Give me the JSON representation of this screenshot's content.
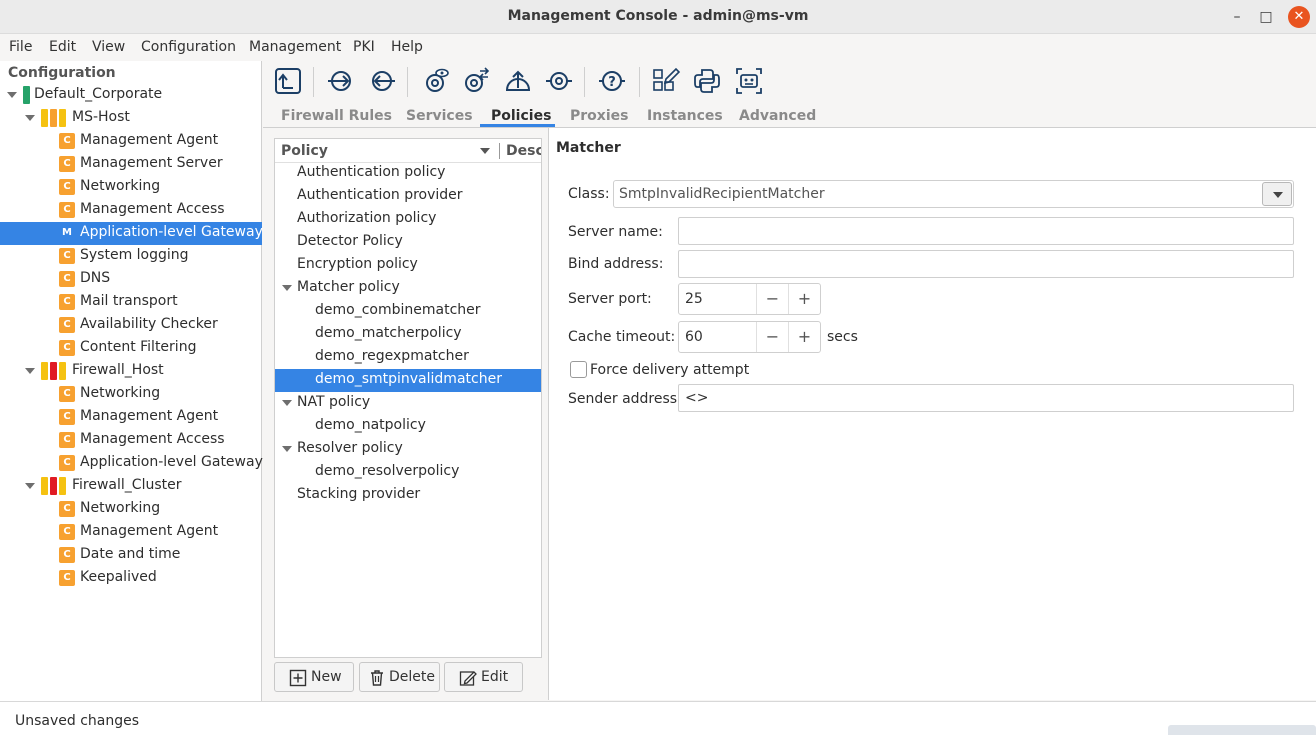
{
  "window": {
    "title": "Management Console - admin@ms-vm",
    "minimize": "–",
    "maximize": "□",
    "close": "✕"
  },
  "menu": [
    "File",
    "Edit",
    "View",
    "Configuration",
    "Management",
    "PKI",
    "Help"
  ],
  "tree": {
    "header": "Configuration",
    "root": "Default_Corporate",
    "hosts": [
      {
        "name": "MS-Host",
        "components": [
          "Management Agent",
          "Management Server",
          "Networking",
          "Management Access",
          "Application-level Gateway",
          "System logging",
          "DNS",
          "Mail transport",
          "Availability Checker",
          "Content Filtering"
        ]
      },
      {
        "name": "Firewall_Host",
        "components": [
          "Networking",
          "Management Agent",
          "Management Access",
          "Application-level Gateway"
        ]
      },
      {
        "name": "Firewall_Cluster",
        "components": [
          "Networking",
          "Management Agent",
          "Date and time",
          "Keepalived"
        ]
      }
    ],
    "badge_c": "C",
    "badge_m": "M",
    "selected": "Application-level Gateway"
  },
  "toolbar_icons": [
    "upload-arrow-icon",
    "connect-icon",
    "disconnect-icon",
    "view-config-icon",
    "compare-icon",
    "upload-config-icon",
    "control-service-icon",
    "help-icon",
    "edit-layout-icon",
    "python-icon",
    "status-monitor-icon"
  ],
  "tabs": [
    "Firewall Rules",
    "Services",
    "Policies",
    "Proxies",
    "Instances",
    "Advanced"
  ],
  "active_tab": "Policies",
  "policy_list": {
    "col_policy": "Policy",
    "col_desc": "Description",
    "rows": [
      {
        "label": "Authentication policy",
        "level": 0
      },
      {
        "label": "Authentication provider",
        "level": 0
      },
      {
        "label": "Authorization policy",
        "level": 0
      },
      {
        "label": "Detector Policy",
        "level": 0
      },
      {
        "label": "Encryption policy",
        "level": 0
      },
      {
        "label": "Matcher policy",
        "level": 0,
        "expanded": true
      },
      {
        "label": "demo_combinematcher",
        "level": 1
      },
      {
        "label": "demo_matcherpolicy",
        "level": 1
      },
      {
        "label": "demo_regexpmatcher",
        "level": 1
      },
      {
        "label": "demo_smtpinvalidmatcher",
        "level": 1,
        "selected": true
      },
      {
        "label": "NAT policy",
        "level": 0,
        "expanded": true
      },
      {
        "label": "demo_natpolicy",
        "level": 1
      },
      {
        "label": "Resolver policy",
        "level": 0,
        "expanded": true
      },
      {
        "label": "demo_resolverpolicy",
        "level": 1
      },
      {
        "label": "Stacking provider",
        "level": 0
      }
    ],
    "buttons": {
      "new": "New",
      "delete": "Delete",
      "edit": "Edit"
    }
  },
  "detail": {
    "title": "Matcher",
    "class_label": "Class:",
    "class_value": "SmtpInvalidRecipientMatcher",
    "server_name_label": "Server name:",
    "server_name_value": "",
    "bind_address_label": "Bind address:",
    "bind_address_value": "",
    "server_port_label": "Server port:",
    "server_port_value": "25",
    "cache_timeout_label": "Cache timeout:",
    "cache_timeout_value": "60",
    "cache_timeout_unit": "secs",
    "force_delivery_label": "Force delivery attempt",
    "force_delivery_checked": false,
    "sender_address_label": "Sender address:",
    "sender_address_value": "<>",
    "minus": "−",
    "plus": "+"
  },
  "status": {
    "text": "Unsaved changes"
  },
  "colors": {
    "accent": "#3584e4",
    "component_badge": "#f7a130",
    "close_button": "#e95420",
    "host_green": "#26a269",
    "host_yellow": "#f5c211",
    "host_orange": "#f7a130",
    "host_red": "#e01b24"
  }
}
